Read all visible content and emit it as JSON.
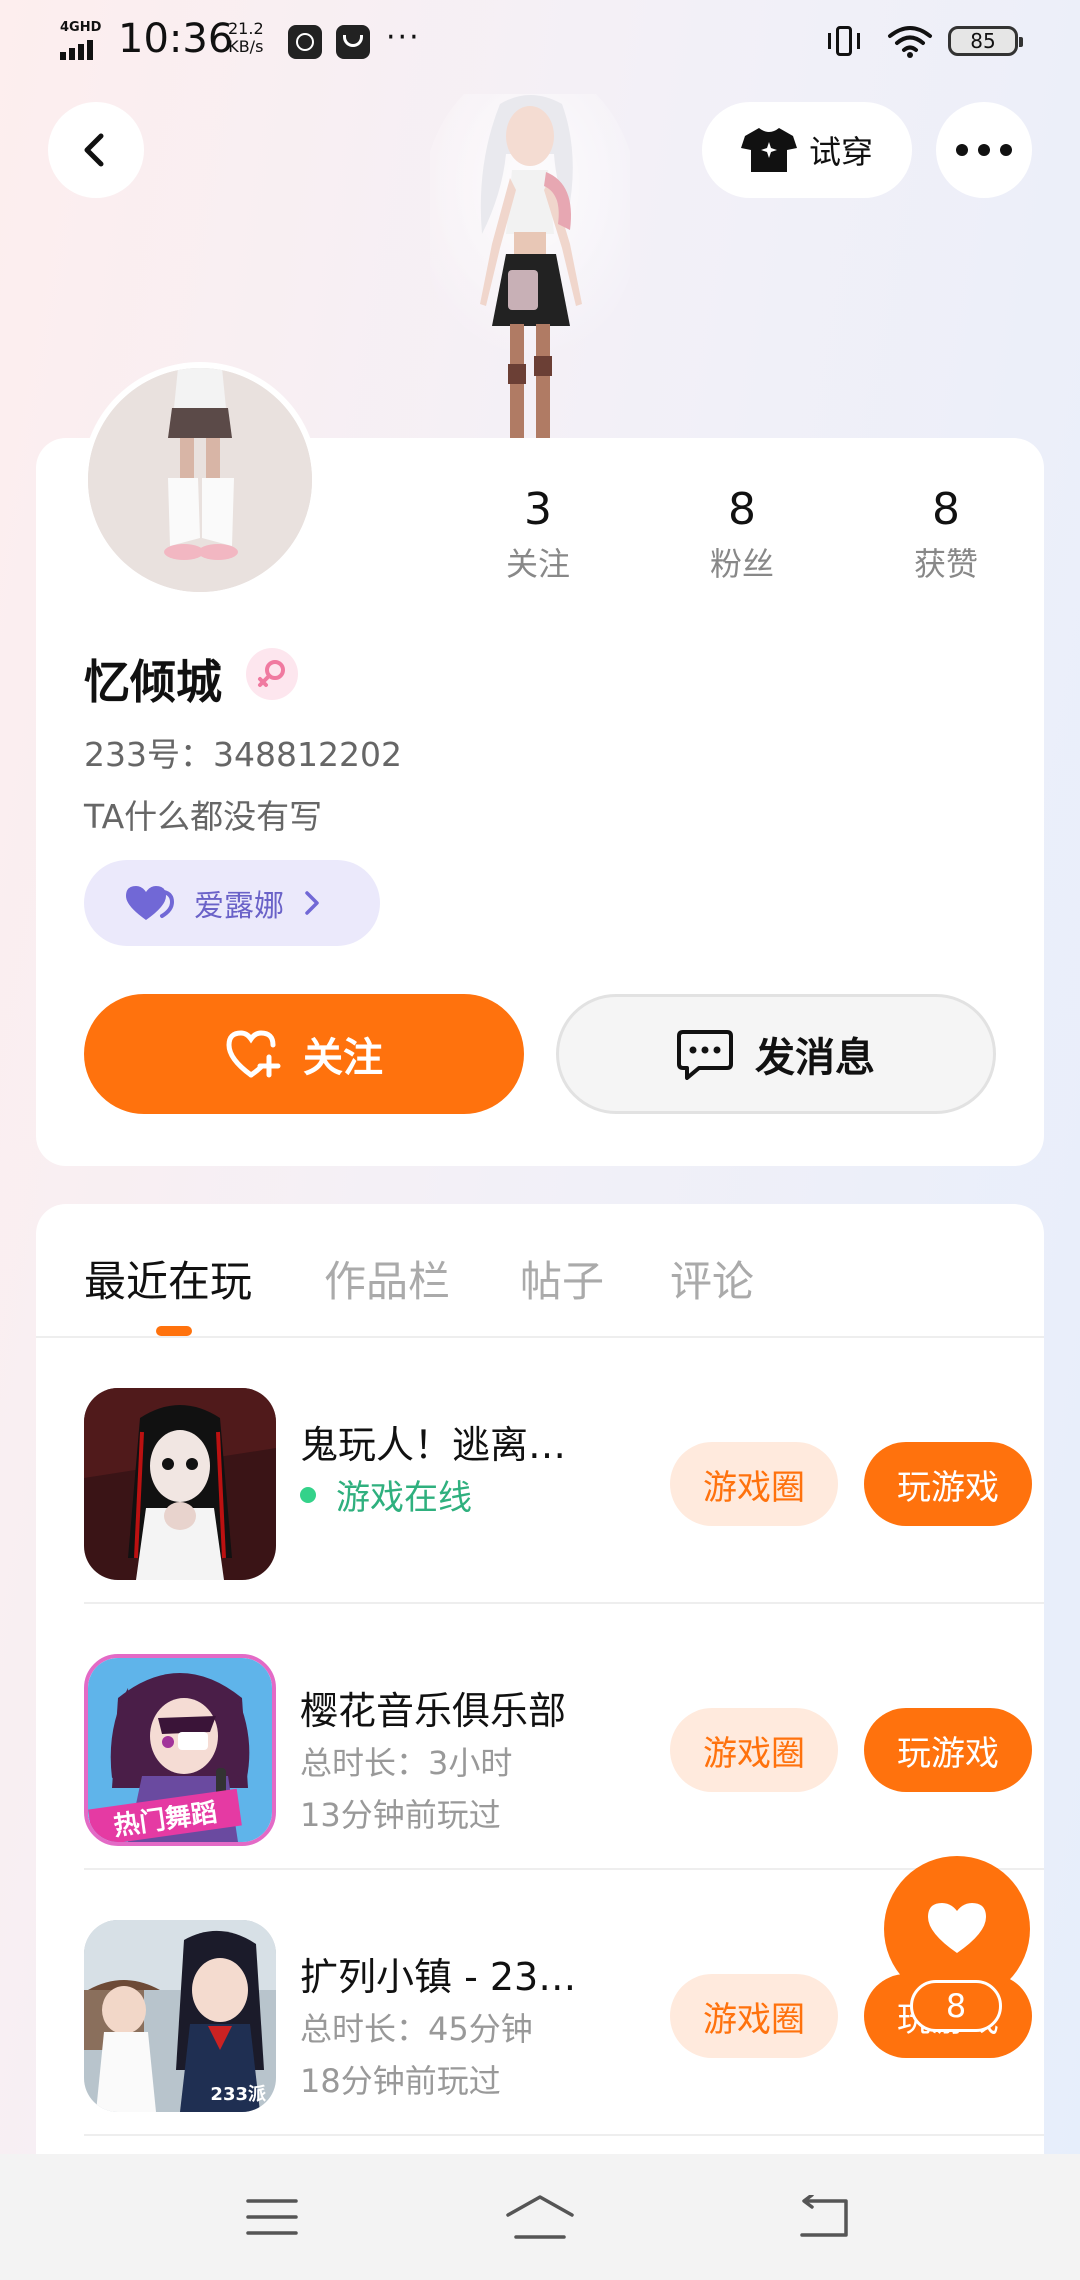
{
  "status_bar": {
    "network_label": "4GHD",
    "time": "10:36",
    "speed_value": "21.2",
    "speed_unit": "KB/s",
    "overflow": "···",
    "battery": "85"
  },
  "header": {
    "tryon_label": "试穿"
  },
  "profile": {
    "stats": [
      {
        "value": "3",
        "label": "关注"
      },
      {
        "value": "8",
        "label": "粉丝"
      },
      {
        "value": "8",
        "label": "获赞"
      }
    ],
    "nickname": "忆倾城",
    "uid": "233号：348812202",
    "bio": "TA什么都没有写",
    "pet_chip": "爱露娜",
    "follow_label": "关注",
    "message_label": "发消息"
  },
  "tabs": [
    {
      "label": "最近在玩",
      "active": true
    },
    {
      "label": "作品栏",
      "active": false
    },
    {
      "label": "帖子",
      "active": false
    },
    {
      "label": "评论",
      "active": false
    }
  ],
  "games": [
    {
      "title": "鬼玩人！逃离…",
      "online_text": "游戏在线",
      "circle_label": "游戏圈",
      "play_label": "玩游戏"
    },
    {
      "title": "樱花音乐俱乐部",
      "duration": "总时长：3小时",
      "last_played": "13分钟前玩过",
      "circle_label": "游戏圈",
      "play_label": "玩游戏",
      "badge_text": "热门舞蹈"
    },
    {
      "title": "扩列小镇 - 23…",
      "duration": "总时长：45分钟",
      "last_played": "18分钟前玩过",
      "circle_label": "游戏圈",
      "play_label": "玩游戏",
      "badge_text": "233派"
    }
  ],
  "fab": {
    "count": "8"
  },
  "colors": {
    "accent": "#ff720d",
    "online": "#2fb07e",
    "pet_chip_bg": "#ebe9fb"
  }
}
